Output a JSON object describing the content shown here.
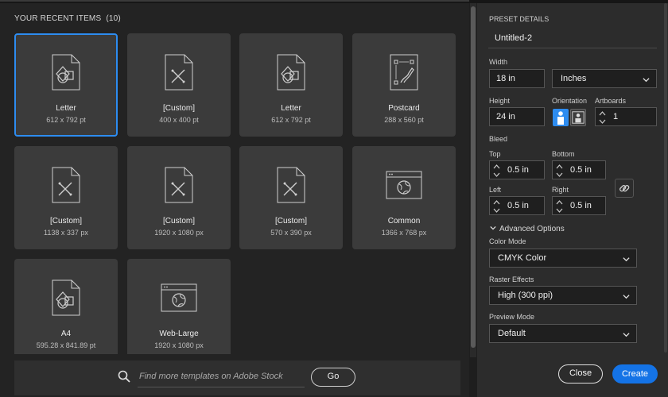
{
  "recent": {
    "title": "YOUR RECENT ITEMS",
    "count": "(10)",
    "items": [
      {
        "name": "Letter",
        "size": "612 x 792 pt",
        "icon": "document-shapes-icon"
      },
      {
        "name": "[Custom]",
        "size": "400 x 400 pt",
        "icon": "document-pen-icon"
      },
      {
        "name": "Letter",
        "size": "612 x 792 pt",
        "icon": "document-shapes-icon"
      },
      {
        "name": "Postcard",
        "size": "288 x 560 pt",
        "icon": "postcard-icon"
      },
      {
        "name": "[Custom]",
        "size": "1138 x 337 px",
        "icon": "document-pen-icon"
      },
      {
        "name": "[Custom]",
        "size": "1920 x 1080 px",
        "icon": "document-pen-icon"
      },
      {
        "name": "[Custom]",
        "size": "570 x 390 px",
        "icon": "document-pen-icon"
      },
      {
        "name": "Common",
        "size": "1366 x 768 px",
        "icon": "browser-globe-icon"
      },
      {
        "name": "A4",
        "size": "595.28 x 841.89 pt",
        "icon": "document-shapes-icon"
      },
      {
        "name": "Web-Large",
        "size": "1920 x 1080 px",
        "icon": "browser-globe-icon"
      }
    ]
  },
  "stock": {
    "placeholder": "Find more templates on Adobe Stock",
    "go_label": "Go"
  },
  "preset": {
    "header": "PRESET DETAILS",
    "name": "Untitled-2",
    "width_label": "Width",
    "width_value": "18 in",
    "units_value": "Inches",
    "height_label": "Height",
    "height_value": "24 in",
    "orientation_label": "Orientation",
    "artboards_label": "Artboards",
    "artboards_value": "1",
    "bleed_label": "Bleed",
    "top_label": "Top",
    "top_value": "0.5 in",
    "bottom_label": "Bottom",
    "bottom_value": "0.5 in",
    "left_label": "Left",
    "left_value": "0.5 in",
    "right_label": "Right",
    "right_value": "0.5 in",
    "advanced_label": "Advanced Options",
    "color_mode_label": "Color Mode",
    "color_mode_value": "CMYK Color",
    "raster_label": "Raster Effects",
    "raster_value": "High (300 ppi)",
    "preview_label": "Preview Mode",
    "preview_value": "Default"
  },
  "actions": {
    "close_label": "Close",
    "create_label": "Create"
  },
  "colors": {
    "accent": "#1473e6",
    "selection": "#2d8cf0"
  }
}
